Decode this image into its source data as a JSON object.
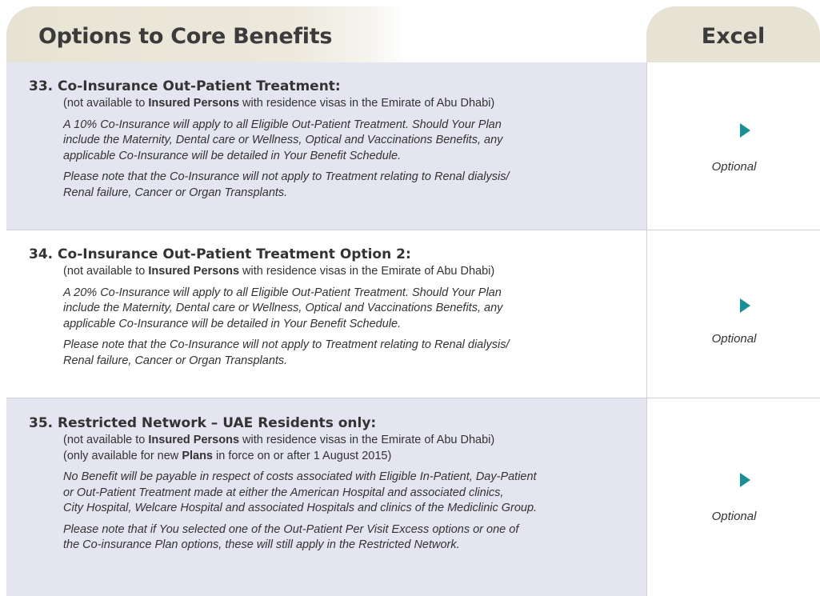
{
  "header": {
    "title": "Options to Core Benefits",
    "column": "Excel"
  },
  "rows": [
    {
      "number_title": "33. Co-Insurance Out-Patient Treatment:",
      "lines": [
        {
          "pre": "(not available to ",
          "bold": "Insured Persons",
          "post": " with residence visas in the Emirate of Abu Dhabi)"
        }
      ],
      "para1": "A 10% Co-Insurance will apply to all Eligible Out-Patient Treatment. Should Your Plan include the Maternity, Dental care or Wellness, Optical and Vaccinations Benefits, any applicable Co-Insurance will be detailed in Your Benefit Schedule.",
      "para1_lines": [
        "A 10% Co-Insurance will apply to all Eligible Out-Patient Treatment. Should Your Plan",
        "include the Maternity, Dental care or Wellness, Optical and Vaccinations Benefits, any",
        "applicable Co-Insurance will be detailed in Your Benefit Schedule."
      ],
      "para2_lines": [
        "Please note that the Co-Insurance will not apply to Treatment relating to Renal dialysis/",
        "Renal failure, Cancer or Organ Transplants."
      ],
      "status": "Optional"
    },
    {
      "number_title": "34. Co-Insurance Out-Patient Treatment Option 2:",
      "lines": [
        {
          "pre": "(not available to ",
          "bold": "Insured Persons",
          "post": " with residence visas in the Emirate of Abu Dhabi)"
        }
      ],
      "para1_lines": [
        "A 20% Co-Insurance will apply to all Eligible Out-Patient Treatment. Should Your Plan",
        "include the Maternity, Dental care or Wellness, Optical and Vaccinations Benefits, any",
        "applicable Co-Insurance will be detailed in Your Benefit Schedule."
      ],
      "para2_lines": [
        "Please note that the Co-Insurance will not apply to Treatment relating to Renal dialysis/",
        "Renal failure, Cancer or Organ Transplants."
      ],
      "status": "Optional"
    },
    {
      "number_title": "35. Restricted Network – UAE Residents only:",
      "lines": [
        {
          "pre": "(not available to ",
          "bold": "Insured Persons",
          "post": " with residence visas in the Emirate of Abu Dhabi)"
        },
        {
          "pre": "(only available for new ",
          "bold": "Plans",
          "post": " in force on or after 1 August 2015)"
        }
      ],
      "para1_lines": [
        "No Benefit will be payable in respect of costs associated with Eligible In-Patient, Day-Patient",
        "or Out-Patient Treatment made at either the American Hospital and associated clinics,",
        "City Hospital, Welcare Hospital and associated Hospitals and clinics of the Mediclinic Group."
      ],
      "para2_lines": [
        "Please note that if You selected one of the Out-Patient Per Visit Excess options or one of",
        "the Co-insurance Plan options, these will still apply in the Restricted Network."
      ],
      "status": "Optional"
    }
  ]
}
